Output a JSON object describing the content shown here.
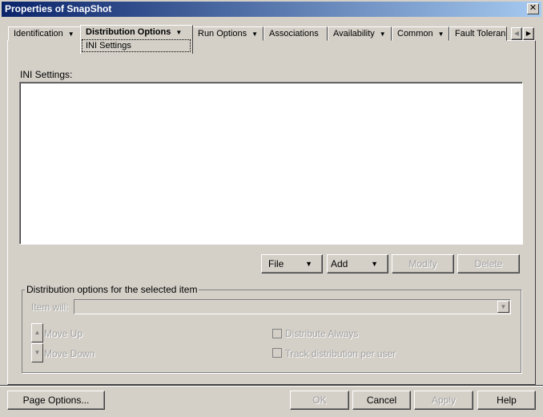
{
  "window": {
    "title": "Properties of SnapShot",
    "close_icon": "close-icon"
  },
  "tabs": [
    {
      "label": "Identification",
      "has_menu": true
    },
    {
      "label": "Distribution Options",
      "has_menu": true,
      "active": true
    },
    {
      "label": "Run Options",
      "has_menu": true
    },
    {
      "label": "Associations",
      "has_menu": false
    },
    {
      "label": "Availability",
      "has_menu": true
    },
    {
      "label": "Common",
      "has_menu": true
    },
    {
      "label": "Fault Toleran",
      "has_menu": false
    }
  ],
  "subtab": "INI Settings",
  "ini": {
    "label": "INI Settings:",
    "items": []
  },
  "list_buttons": {
    "file": "File",
    "add": "Add",
    "modify": "Modify",
    "delete": "Delete"
  },
  "group": {
    "title": "Distribution options for the selected item",
    "item_will_label": "Item will:",
    "item_will_value": "",
    "move_up": "Move Up",
    "move_down": "Move Down",
    "distribute_always": "Distribute Always",
    "track_per_user": "Track distribution per user"
  },
  "footer": {
    "page_options": "Page Options...",
    "ok": "OK",
    "cancel": "Cancel",
    "apply": "Apply",
    "help": "Help"
  }
}
